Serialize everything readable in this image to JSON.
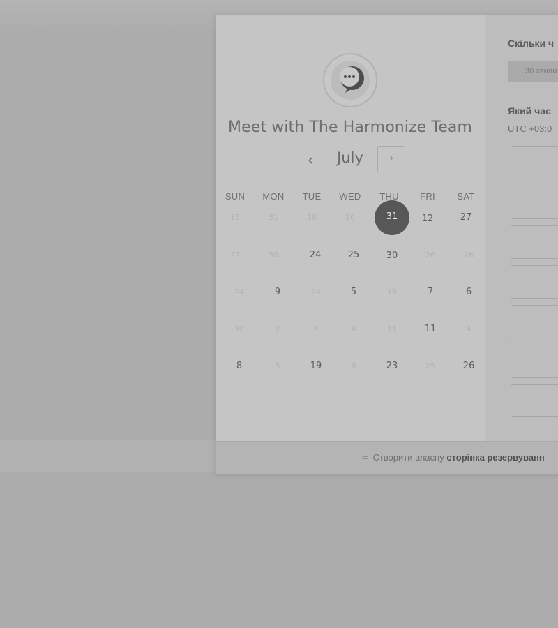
{
  "header": {
    "title": "Meet with The Harmonize Team",
    "avatar_icon": "chat-bubble-icon"
  },
  "calendar": {
    "month": "July",
    "prev_icon": "‹",
    "next_icon": "›",
    "weekdays": [
      "SUN",
      "MON",
      "TUE",
      "WED",
      "THU",
      "FRI",
      "SAT"
    ],
    "weeks": [
      [
        {
          "label": "15",
          "muted": true
        },
        {
          "label": "31",
          "muted": true
        },
        {
          "label": "18",
          "muted": true
        },
        {
          "label": "20",
          "muted": true
        },
        {
          "label": "31",
          "selected": true
        },
        {
          "label": "12"
        },
        {
          "label": "27"
        }
      ],
      [
        {
          "label": "27",
          "muted": true
        },
        {
          "label": "30",
          "muted": true
        },
        {
          "label": "24"
        },
        {
          "label": "25"
        },
        {
          "label": "30"
        },
        {
          "label": "26",
          "muted": true
        },
        {
          "label": "26",
          "muted": true
        }
      ],
      [
        {
          "label": "24",
          "muted": true
        },
        {
          "label": "9"
        },
        {
          "label": "24",
          "muted": true
        },
        {
          "label": "5"
        },
        {
          "label": "18",
          "muted": true
        },
        {
          "label": "7"
        },
        {
          "label": "6"
        }
      ],
      [
        {
          "label": "30",
          "muted": true
        },
        {
          "label": "2",
          "muted": true
        },
        {
          "label": "6",
          "muted": true
        },
        {
          "label": "4",
          "muted": true
        },
        {
          "label": "11",
          "muted": true
        },
        {
          "label": "11"
        },
        {
          "label": "4",
          "muted": true
        }
      ],
      [
        {
          "label": "8"
        },
        {
          "label": "3",
          "muted": true
        },
        {
          "label": "19"
        },
        {
          "label": "8",
          "muted": true
        },
        {
          "label": "23"
        },
        {
          "label": "25",
          "muted": true
        },
        {
          "label": "26"
        }
      ]
    ]
  },
  "booking": {
    "duration_heading": "Скільки ч",
    "duration_button": "30 хвили",
    "time_heading": "Який час",
    "timezone": "UTC +03:0",
    "slot_count": 7
  },
  "footer": {
    "icon": "hubspot-sprocket-icon",
    "text_plain": "Створити власну",
    "text_bold": "сторінка резервуванн"
  },
  "colors": {
    "selected_day": "#575757",
    "panel": "#c5c5c5",
    "overlay": "#acacac"
  }
}
